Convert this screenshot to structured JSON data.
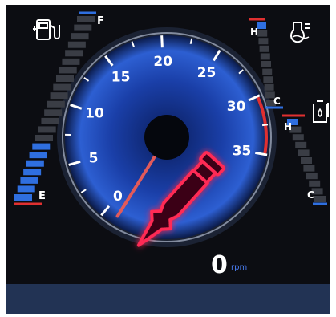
{
  "gauge": {
    "ticks": [
      "0",
      "5",
      "10",
      "15",
      "20",
      "25",
      "30",
      "35"
    ],
    "value": 0,
    "unit": "rpm",
    "value_text": "0"
  },
  "fuel": {
    "full_label": "F",
    "empty_label": "E",
    "level_fraction": 0.3
  },
  "coolant": {
    "hot_label": "H",
    "cold_label": "C",
    "level_fraction": 0.05
  },
  "oil": {
    "hot_label": "H",
    "cold_label": "C",
    "level_fraction": 0.05
  },
  "warning": {
    "icon": "drill-bit-warning-icon",
    "color": "#ff2a55"
  },
  "colors": {
    "accent_blue": "#2f6fe0",
    "redline": "#e03030",
    "needle": "#e25a5a"
  }
}
